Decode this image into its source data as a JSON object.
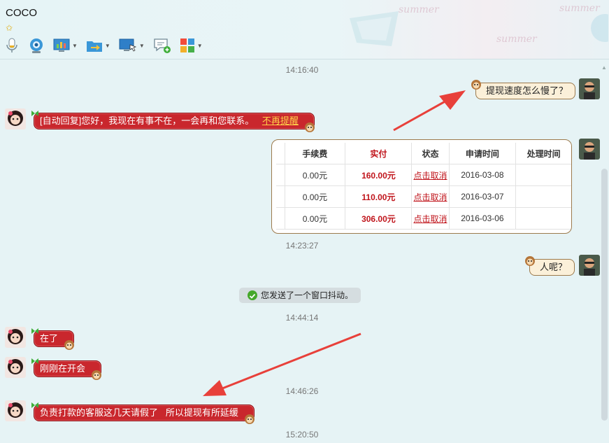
{
  "window": {
    "title": "COCO",
    "rating_icon": "star-icon"
  },
  "toolbar": {
    "items": [
      {
        "icon": "microphone-icon",
        "dropdown": false
      },
      {
        "icon": "webcam-icon",
        "dropdown": false
      },
      {
        "icon": "screen-share-icon",
        "dropdown": true
      },
      {
        "icon": "file-transfer-icon",
        "dropdown": true
      },
      {
        "icon": "remote-desktop-icon",
        "dropdown": true
      },
      {
        "icon": "new-discussion-icon",
        "dropdown": false
      },
      {
        "icon": "apps-icon",
        "dropdown": true
      }
    ]
  },
  "messages": {
    "t1": "14:16:40",
    "m1": "提现速度怎么慢了？",
    "m2_text": "[自动回复]您好，我现在有事不在，一会再和您联系。",
    "m2_link": "不再提醒",
    "t2": "14:23:27",
    "m3": "人呢？",
    "system": "您发送了一个窗口抖动。",
    "t3": "14:44:14",
    "m4": "在了",
    "m5": "刚刚在开会",
    "t4": "14:46:26",
    "m6": "负责打款的客服这几天请假了   所以提现有所延缓",
    "t5": "15:20:50"
  },
  "table": {
    "headers": [
      "手续费",
      "实付",
      "状态",
      "申请时间",
      "处理时间"
    ],
    "rows": [
      {
        "fee": "0.00元",
        "paid": "160.00元",
        "status": "点击取消",
        "date": "2016-03-08",
        "processed": ""
      },
      {
        "fee": "0.00元",
        "paid": "110.00元",
        "status": "点击取消",
        "date": "2016-03-07",
        "processed": ""
      },
      {
        "fee": "0.00元",
        "paid": "306.00元",
        "status": "点击取消",
        "date": "2016-03-06",
        "processed": ""
      }
    ]
  },
  "colors": {
    "reply_bubble": "#c9272d",
    "self_bubble": "#fbf0d9",
    "annotation_arrow": "#e8403a",
    "link": "#ffd24a"
  }
}
